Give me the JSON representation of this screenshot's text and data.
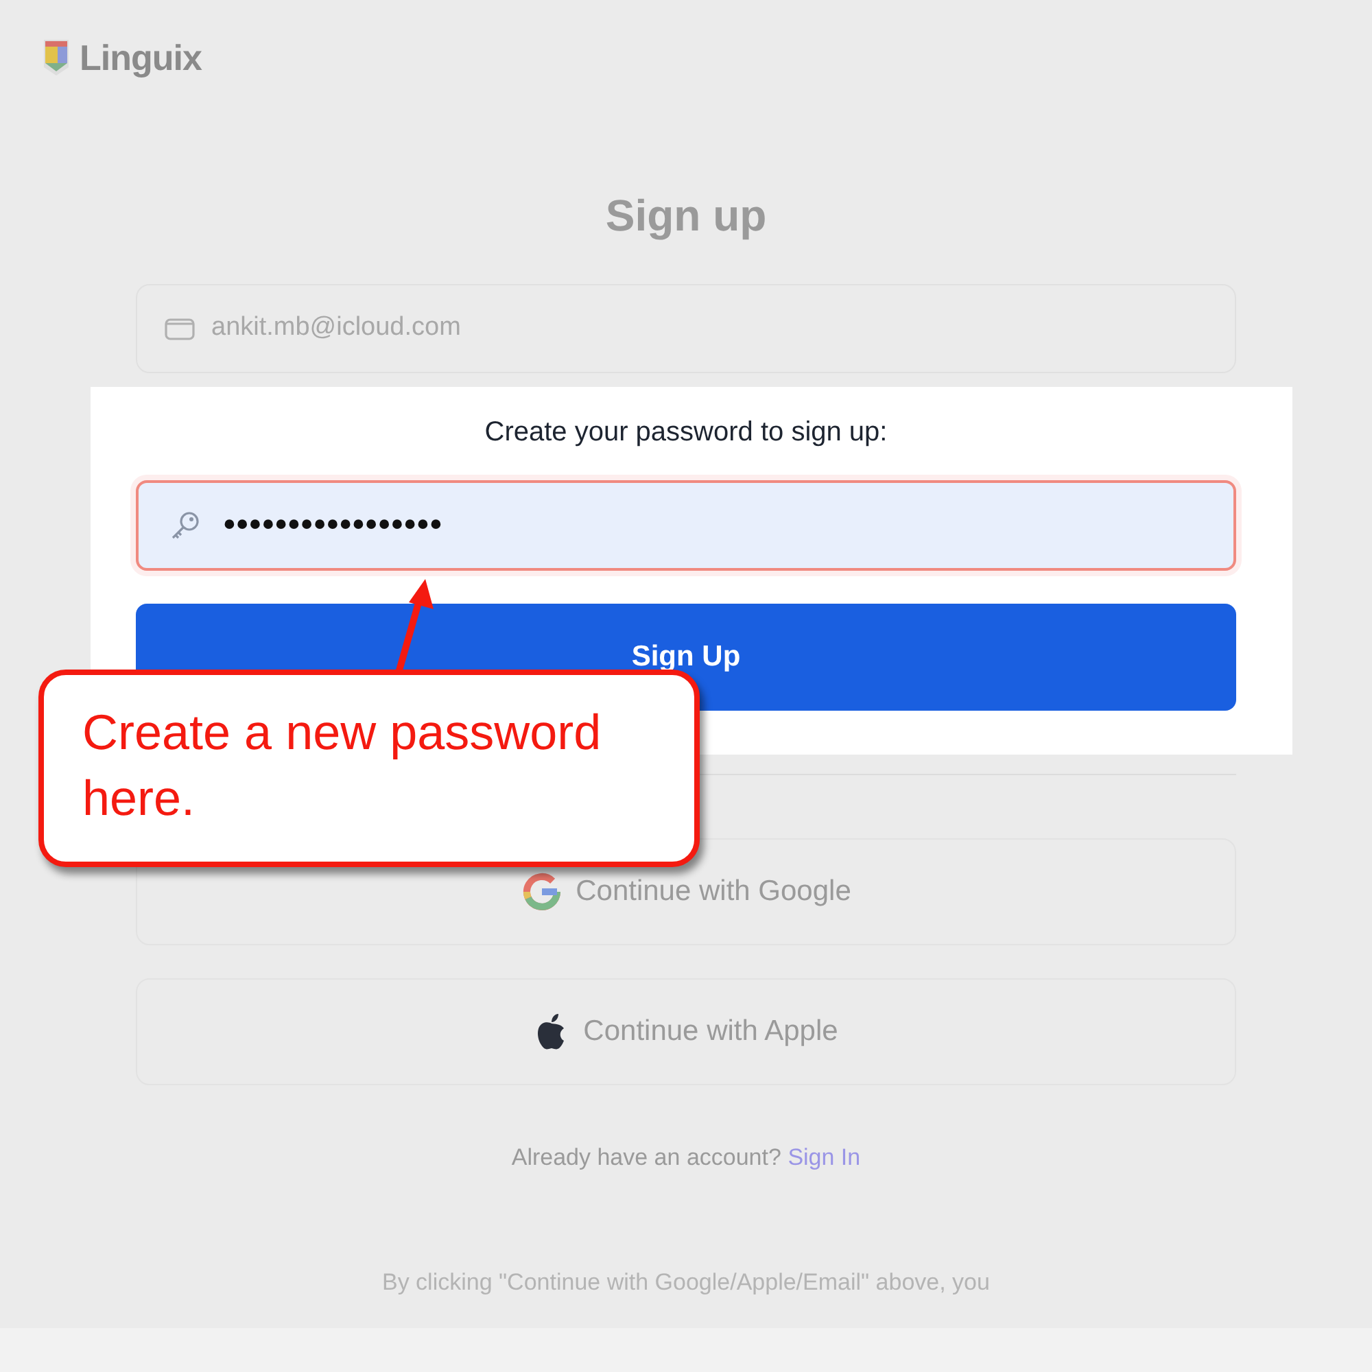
{
  "logo": {
    "text": "Linguix"
  },
  "title": "Sign up",
  "email_field": {
    "value": "ankit.mb@icloud.com"
  },
  "highlight": {
    "prompt": "Create your password to sign up:",
    "password_field": {
      "value": "•••••••••••••••••",
      "invalid": true
    },
    "submit_button": "Sign Up"
  },
  "social_buttons": [
    {
      "kind": "google",
      "label": "Continue with Google"
    },
    {
      "kind": "apple",
      "label": "Continue with Apple"
    }
  ],
  "signin_prompt": {
    "text": "Already have an account?",
    "link": "Sign In"
  },
  "legal_lines": [
    "By clicking \"Continue with Google/Apple/Email\" above, you"
  ],
  "callout": {
    "text": "Create a new password here."
  }
}
